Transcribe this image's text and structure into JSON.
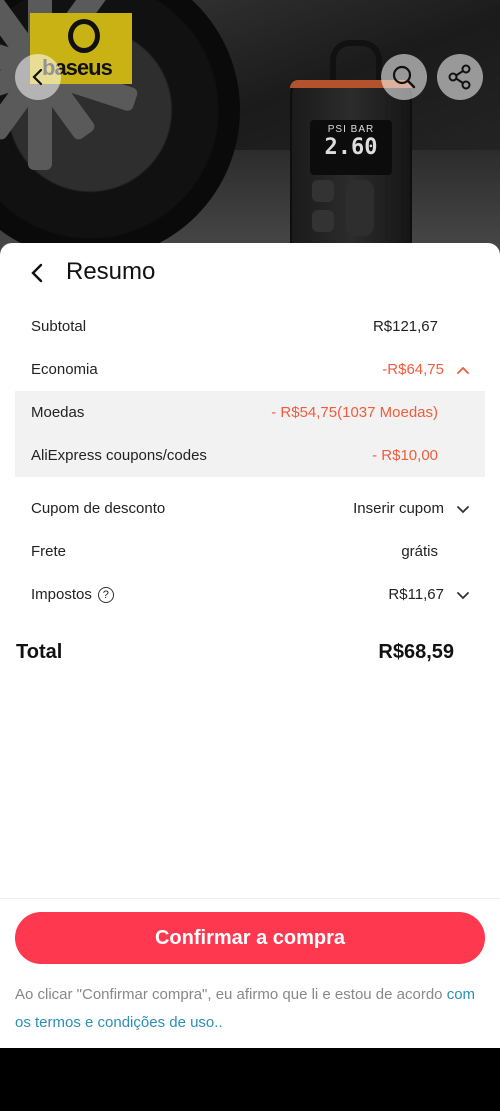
{
  "hero": {
    "brand_logo_text": "baseus",
    "product_display": {
      "label": "PSI BAR",
      "value": "2.60"
    }
  },
  "summary": {
    "title": "Resumo",
    "subtotal": {
      "label": "Subtotal",
      "value": "R$121,67"
    },
    "economia": {
      "label": "Economia",
      "value": "-R$64,75"
    },
    "moedas": {
      "label": "Moedas",
      "value": "- R$54,75(1037 Moedas)"
    },
    "coupons": {
      "label": "AliExpress coupons/codes",
      "value": "- R$10,00"
    },
    "cupom": {
      "label": "Cupom de desconto",
      "value": "Inserir cupom"
    },
    "frete": {
      "label": "Frete",
      "value": "grátis"
    },
    "impostos": {
      "label": "Impostos",
      "value": "R$11,67"
    },
    "total": {
      "label": "Total",
      "value": "R$68,59"
    }
  },
  "footer": {
    "confirm_label": "Confirmar a compra",
    "legal_text": "Ao clicar \"Confirmar compra\", eu afirmo que li e estou de acordo ",
    "legal_link": "com os termos e condições de uso.."
  },
  "colors": {
    "accent": "#fd384f",
    "discount": "#f25c3c",
    "link": "#2b8fb7"
  }
}
